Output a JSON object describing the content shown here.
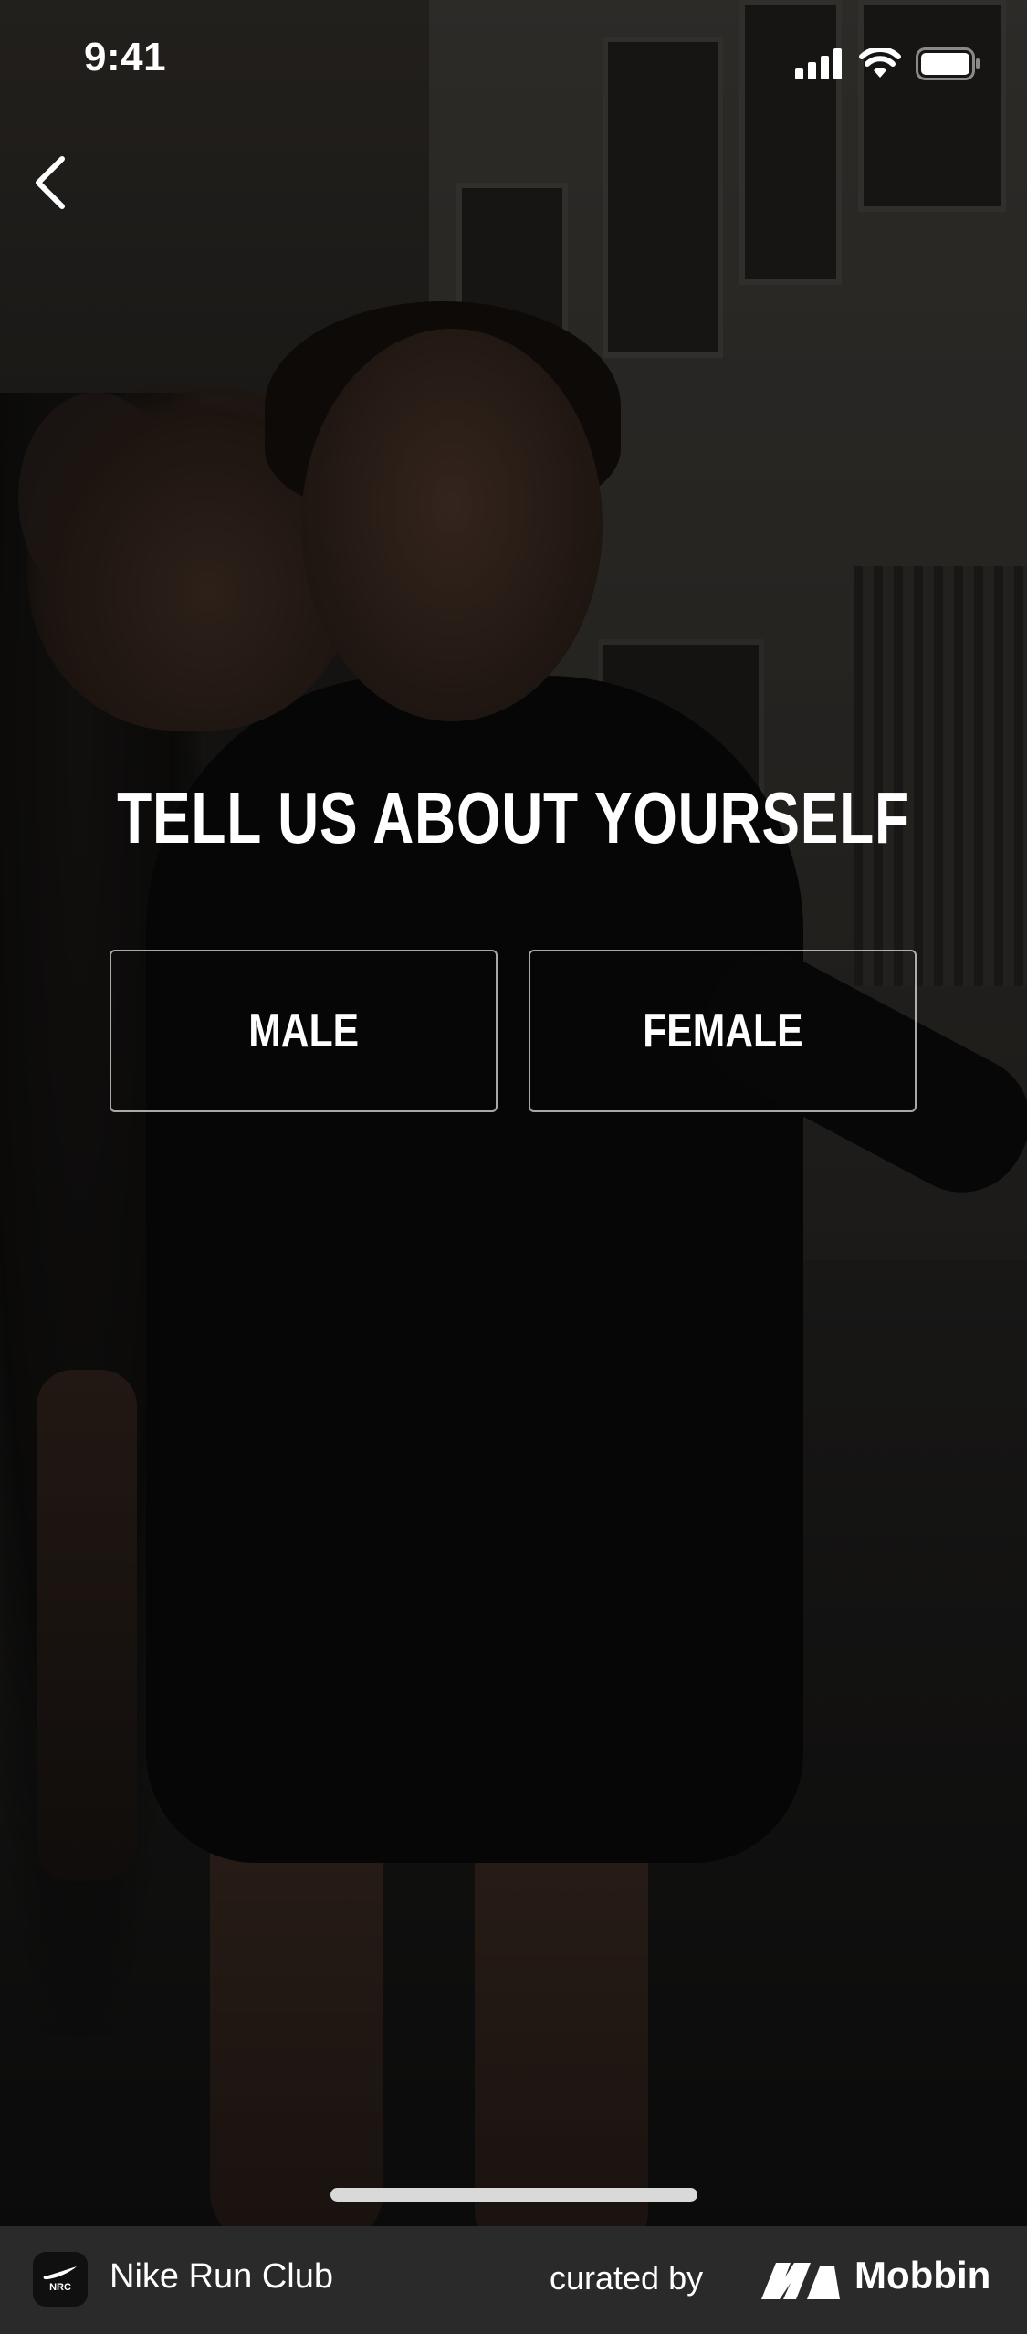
{
  "status_bar": {
    "time": "9:41",
    "icons": [
      "signal-icon",
      "wifi-icon",
      "battery-icon"
    ]
  },
  "nav": {
    "back_icon": "chevron-left-icon"
  },
  "onboarding": {
    "title": "TELL US ABOUT YOURSELF",
    "options": {
      "male": "MALE",
      "female": "FEMALE"
    }
  },
  "attribution": {
    "app_logo_text": "NRC",
    "app_name": "Nike Run Club",
    "curated_by": "curated by",
    "brand_name": "Mobbin"
  },
  "colors": {
    "text": "#ffffff",
    "button_border": "#a6a6a6",
    "attribution_bg": "#2a2a2a",
    "home_indicator": "#d9d9d9"
  }
}
